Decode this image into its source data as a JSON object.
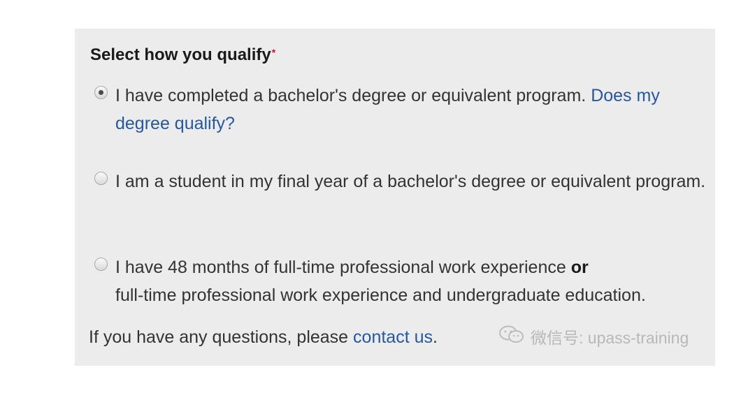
{
  "form": {
    "heading": "Select how you qualify",
    "required_mark": "*",
    "options": [
      {
        "text": "I have completed a bachelor's degree or equivalent program.",
        "link_text": "Does my degree qualify?",
        "checked": true
      },
      {
        "text": "I am a student in my final year of a bachelor's degree or equivalent program.",
        "checked": false
      },
      {
        "text_before": "I have 48 months of full-time professional work experience",
        "bold_word": "or",
        "text_after": "full-time professional work experience and undergraduate education.",
        "checked": false
      }
    ],
    "footer": {
      "text": "If you have any questions, please",
      "link_text": "contact us",
      "end": "."
    }
  },
  "watermark": {
    "icon": "wechat-icon",
    "text": "微信号: upass-training"
  }
}
